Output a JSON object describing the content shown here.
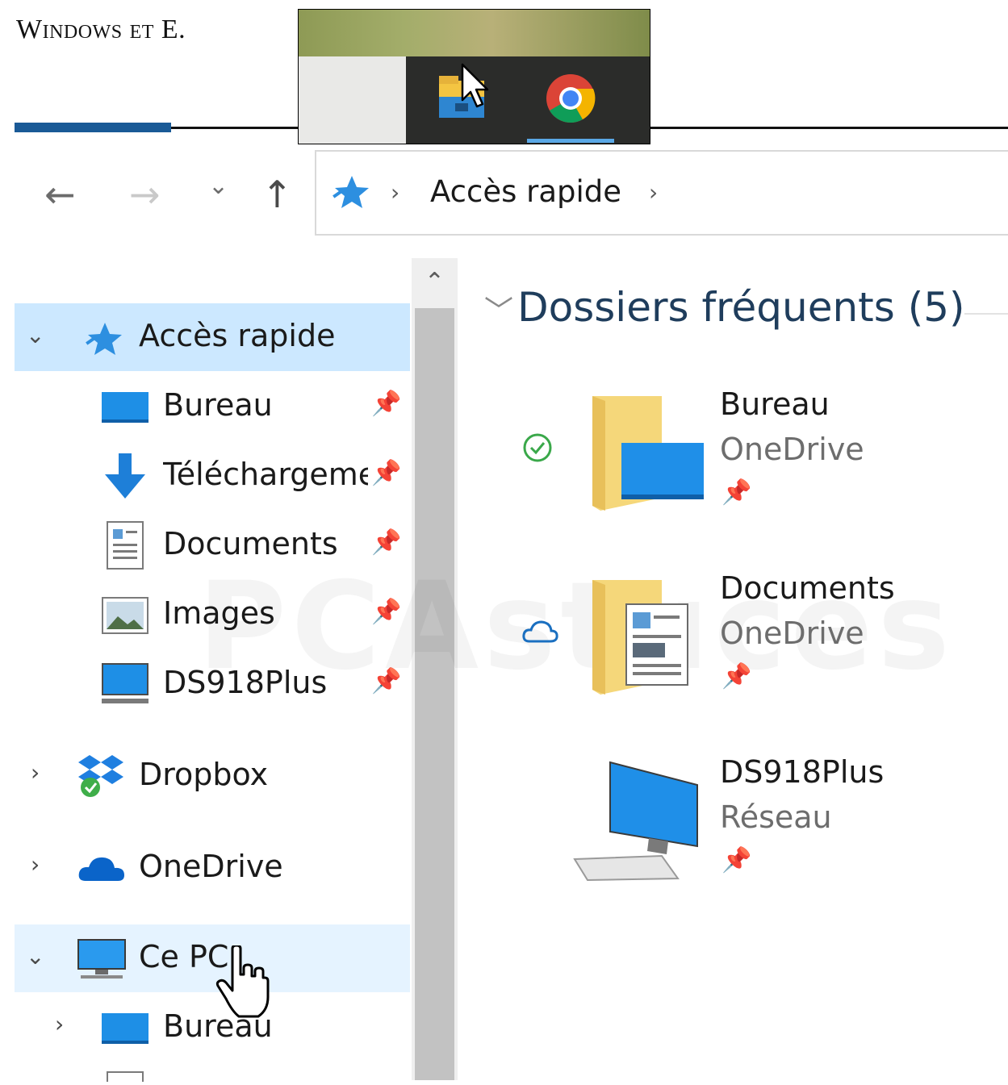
{
  "article": {
    "heading": "Windows et E."
  },
  "watermark": {
    "text": "PCAstuces"
  },
  "navigation": {
    "back": "←",
    "forward": "→",
    "recent": "⌄",
    "up": "↑"
  },
  "address_bar": {
    "crumbs": [
      {
        "label": "Accès rapide"
      }
    ],
    "separator": "›"
  },
  "sidebar": {
    "quick_access": {
      "label": "Accès rapide",
      "expanded": true
    },
    "pinned_items": [
      {
        "label": "Bureau",
        "icon": "desktop-icon"
      },
      {
        "label": "Téléchargeme",
        "icon": "download-icon"
      },
      {
        "label": "Documents",
        "icon": "document-icon"
      },
      {
        "label": "Images",
        "icon": "pictures-icon"
      },
      {
        "label": "DS918Plus",
        "icon": "network-drive-icon"
      }
    ],
    "dropbox": {
      "label": "Dropbox"
    },
    "onedrive": {
      "label": "OneDrive"
    },
    "this_pc": {
      "label": "Ce PC",
      "expanded": true
    },
    "this_pc_children": [
      {
        "label": "Bureau"
      }
    ]
  },
  "main": {
    "section_title": "Dossiers fréquents (5)",
    "tiles": [
      {
        "name": "Bureau",
        "location": "OneDrive",
        "status": "synced",
        "icon": "desktop-folder-icon"
      },
      {
        "name": "Documents",
        "location": "OneDrive",
        "status": "cloud",
        "icon": "documents-folder-icon"
      },
      {
        "name": "DS918Plus",
        "location": "Réseau",
        "status": "",
        "icon": "computer-icon"
      }
    ]
  },
  "colors": {
    "selection": "#cce8ff",
    "hover": "#e5f3ff",
    "folder": "#f5d77a",
    "accent_blue": "#1e90e8",
    "section_title": "#1f3d5c"
  }
}
